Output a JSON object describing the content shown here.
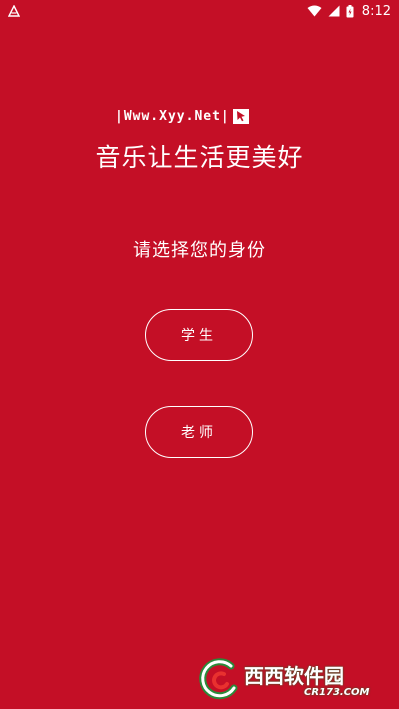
{
  "status_bar": {
    "time": "8:12",
    "icons": [
      "app-notification-icon",
      "wifi-icon",
      "signal-icon",
      "battery-icon"
    ]
  },
  "site_badge": {
    "text": "|Www.Xyy.Net|",
    "arrow_icon": "cursor-arrow-icon"
  },
  "slogan": "音乐让生活更美好",
  "prompt": "请选择您的身份",
  "roles": [
    {
      "label": "学生"
    },
    {
      "label": "老师"
    }
  ],
  "watermark": {
    "brand": "西西软件园",
    "domain": "CR173.COM"
  },
  "colors": {
    "background": "#c40f26",
    "text": "#ffffff"
  }
}
